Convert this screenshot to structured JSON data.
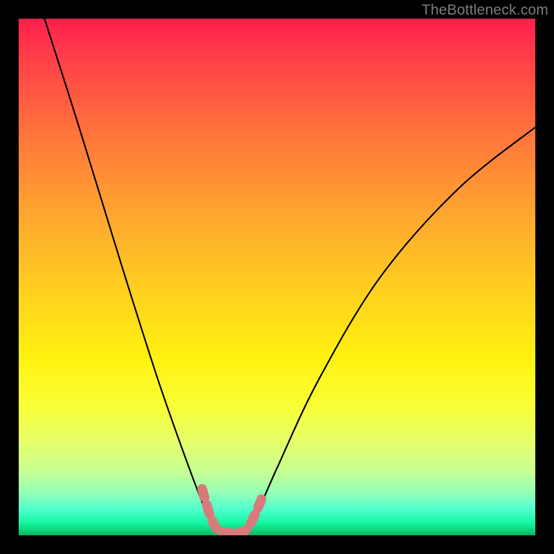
{
  "watermark": "TheBottleneck.com",
  "chart_data": {
    "type": "line",
    "title": "",
    "xlabel": "",
    "ylabel": "",
    "xlim": [
      0,
      100
    ],
    "ylim": [
      0,
      100
    ],
    "grid": false,
    "legend": false,
    "series": [
      {
        "name": "bottleneck-curve",
        "points": [
          {
            "x": 5,
            "y": 100
          },
          {
            "x": 12,
            "y": 78
          },
          {
            "x": 20,
            "y": 52
          },
          {
            "x": 27,
            "y": 30
          },
          {
            "x": 33,
            "y": 13
          },
          {
            "x": 36.5,
            "y": 4
          },
          {
            "x": 38,
            "y": 1
          },
          {
            "x": 40,
            "y": 0.5
          },
          {
            "x": 42,
            "y": 0.5
          },
          {
            "x": 44,
            "y": 1
          },
          {
            "x": 46,
            "y": 4
          },
          {
            "x": 50,
            "y": 13
          },
          {
            "x": 58,
            "y": 30
          },
          {
            "x": 70,
            "y": 50
          },
          {
            "x": 85,
            "y": 67
          },
          {
            "x": 100,
            "y": 79
          }
        ]
      },
      {
        "name": "highlight-segment",
        "points": [
          {
            "x": 35.5,
            "y": 9
          },
          {
            "x": 37,
            "y": 4
          },
          {
            "x": 38.5,
            "y": 1
          },
          {
            "x": 40,
            "y": 0.5
          },
          {
            "x": 42,
            "y": 0.5
          },
          {
            "x": 44,
            "y": 1
          },
          {
            "x": 45.5,
            "y": 3.5
          },
          {
            "x": 47,
            "y": 7
          }
        ]
      }
    ],
    "background_gradient": {
      "top": "#ff1f4d",
      "mid": "#fff210",
      "bottom": "#07b45e"
    }
  }
}
